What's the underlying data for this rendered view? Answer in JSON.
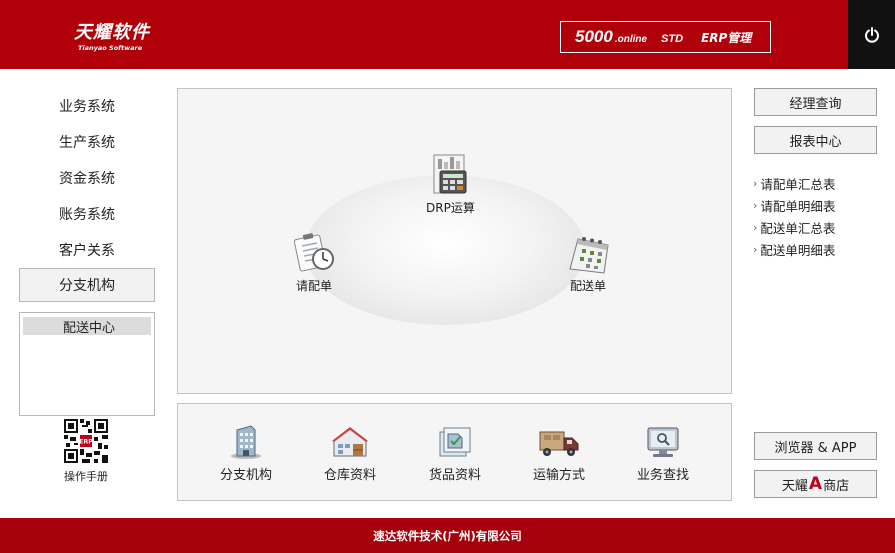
{
  "header": {
    "logo_text": "天耀软件",
    "logo_sub": "Tianyao Software",
    "edition_number": "5000",
    "edition_online": ".online",
    "edition_std": "STD",
    "edition_erp": "ERP管理",
    "power_icon": "power-icon"
  },
  "sidebar": {
    "items": [
      {
        "label": "业务系统"
      },
      {
        "label": "生产系统"
      },
      {
        "label": "资金系统"
      },
      {
        "label": "账务系统"
      },
      {
        "label": "客户关系"
      },
      {
        "label": "分支机构",
        "active": true
      }
    ],
    "branch_list": [
      "配送中心"
    ],
    "manual_label": "操作手册"
  },
  "flow": {
    "nodes": [
      {
        "label": "DRP运算",
        "icon": "calculator-report-icon"
      },
      {
        "label": "请配单",
        "icon": "clipboard-clock-icon"
      },
      {
        "label": "配送单",
        "icon": "calendar-icon"
      }
    ]
  },
  "tools": [
    {
      "label": "分支机构",
      "icon": "building-icon"
    },
    {
      "label": "仓库资料",
      "icon": "warehouse-icon"
    },
    {
      "label": "货品资料",
      "icon": "goods-box-icon"
    },
    {
      "label": "运输方式",
      "icon": "truck-icon"
    },
    {
      "label": "业务查找",
      "icon": "monitor-search-icon"
    }
  ],
  "right": {
    "manager_query": "经理查询",
    "report_center": "报表中心",
    "reports": [
      "请配单汇总表",
      "请配单明细表",
      "配送单汇总表",
      "配送单明细表"
    ],
    "browser_app": "浏览器 & APP",
    "store_prefix": "天耀",
    "store_letter": "A",
    "store_suffix": "商店"
  },
  "footer": {
    "company": "速达软件技术(广州)有限公司"
  },
  "colors": {
    "brand_red": "#b0010a",
    "footer_red": "#a5000b",
    "power_bg": "#111111"
  }
}
